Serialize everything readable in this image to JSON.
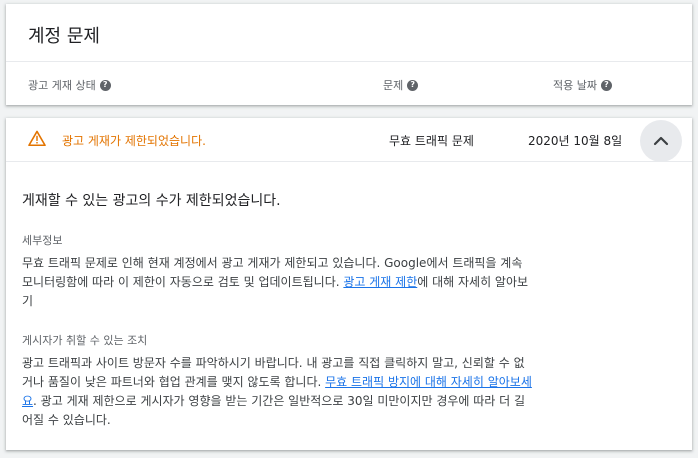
{
  "account_card": {
    "title": "계정 문제",
    "columns": {
      "ad_status": "광고 게재 상태",
      "problem": "문제",
      "date": "적용 날짜"
    },
    "help_glyph": "?"
  },
  "issue": {
    "status": "광고 게재가 제한되었습니다.",
    "problem": "무효 트래픽 문제",
    "date": "2020년 10월 8일",
    "status_color": "#e37400",
    "headline": "게재할 수 있는 광고의 수가 제한되었습니다.",
    "details": {
      "label": "세부정보",
      "text": "무효 트래픽 문제로 인해 현재 계정에서 광고 게재가 제한되고 있습니다. Google에서 트래픽을 계속 모니터링함에 따라 이 제한이 자동으로 검토 및 업데이트됩니다. ",
      "link": "광고 게재 제한",
      "text_after": "에 대해 자세히 알아보기"
    },
    "actions": {
      "label": "게시자가 취할 수 있는 조치",
      "text": "광고 트래픽과 사이트 방문자 수를 파악하시기 바랍니다. 내 광고를 직접 클릭하지 말고, 신뢰할 수 없거나 품질이 낮은 파트너와 협업 관계를 맺지 않도록 합니다. ",
      "link": "무효 트래픽 방지에 대해 자세히 알아보세요",
      "text_after": ". 광고 게재 제한으로 게시자가 영향을 받는 기간은 일반적으로 30일 미만이지만 경우에 따라 더 길어질 수 있습니다."
    }
  },
  "icons": {
    "warning": "warning-icon",
    "help": "help-icon",
    "collapse": "chevron-up-icon"
  },
  "colors": {
    "warning": "#e37400",
    "link": "#1a73e8",
    "toggle_bg": "#e8eaed"
  }
}
